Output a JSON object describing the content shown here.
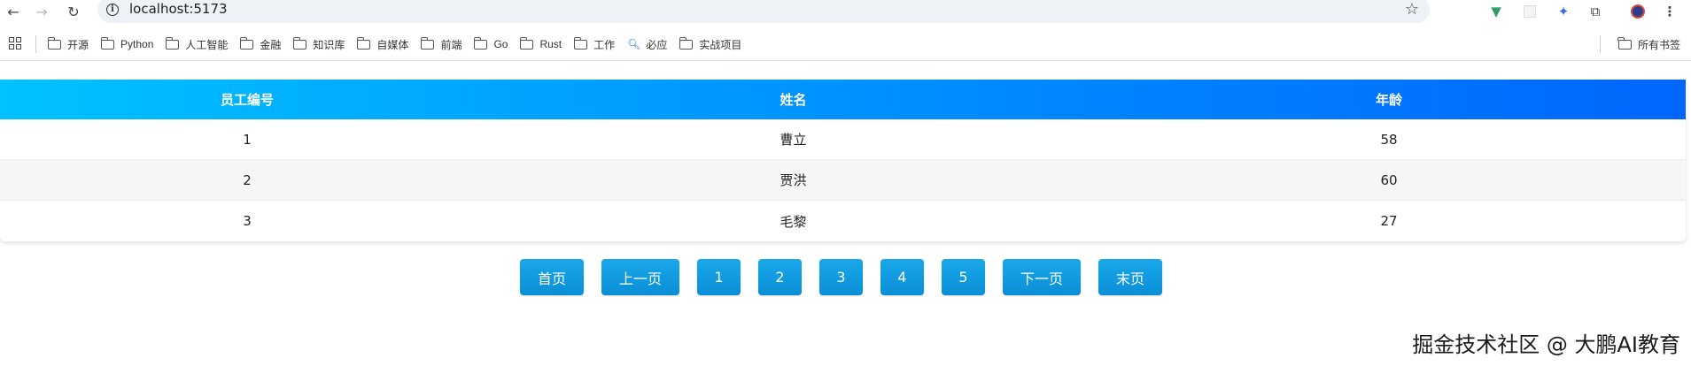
{
  "browser": {
    "url": "localhost:5173",
    "bookmarks": [
      {
        "label": "开源",
        "type": "folder"
      },
      {
        "label": "Python",
        "type": "folder"
      },
      {
        "label": "人工智能",
        "type": "folder"
      },
      {
        "label": "金融",
        "type": "folder"
      },
      {
        "label": "知识库",
        "type": "folder"
      },
      {
        "label": "自媒体",
        "type": "folder"
      },
      {
        "label": "前端",
        "type": "folder"
      },
      {
        "label": "Go",
        "type": "folder"
      },
      {
        "label": "Rust",
        "type": "folder"
      },
      {
        "label": "工作",
        "type": "folder"
      },
      {
        "label": "必应",
        "type": "search"
      },
      {
        "label": "实战项目",
        "type": "folder"
      }
    ],
    "all_bookmarks": "所有书签",
    "extension_icons": [
      "vue-icon",
      "blank-extension-icon",
      "bird-extension-icon",
      "puzzle-icon",
      "profile-icon",
      "menu-icon"
    ]
  },
  "table": {
    "headers": [
      "员工编号",
      "姓名",
      "年龄"
    ],
    "rows": [
      [
        "1",
        "曹立",
        "58"
      ],
      [
        "2",
        "贾洪",
        "60"
      ],
      [
        "3",
        "毛黎",
        "27"
      ]
    ]
  },
  "pagination": {
    "first": "首页",
    "prev": "上一页",
    "pages": [
      "1",
      "2",
      "3",
      "4",
      "5"
    ],
    "next": "下一页",
    "last": "末页"
  },
  "watermark": "掘金技术社区 @ 大鹏AI教育",
  "colors": {
    "header_gradient_start": "#00c2ff",
    "header_gradient_end": "#0066ff",
    "button": "#0a8ed6"
  }
}
